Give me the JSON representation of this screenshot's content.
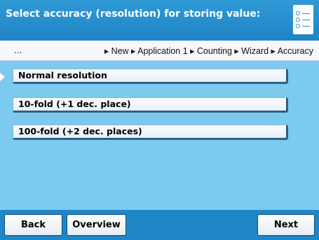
{
  "header": {
    "title": "Select accuracy (resolution) for storing value:",
    "menu_icon": "list-menu-icon"
  },
  "breadcrumb": {
    "ellipsis": "...",
    "path": "▸ New ▸ Application 1 ▸ Counting ▸ Wizard ▸ Accuracy"
  },
  "options": [
    {
      "label": "Normal resolution",
      "selected": true
    },
    {
      "label": "10-fold (+1 dec. place)",
      "selected": false
    },
    {
      "label": "100-fold (+2 dec. places)",
      "selected": false
    }
  ],
  "footer": {
    "back_label": "Back",
    "overview_label": "Overview",
    "next_label": "Next"
  },
  "colors": {
    "header_blue": "#1f84c6",
    "content_blue": "#7ccaef"
  }
}
